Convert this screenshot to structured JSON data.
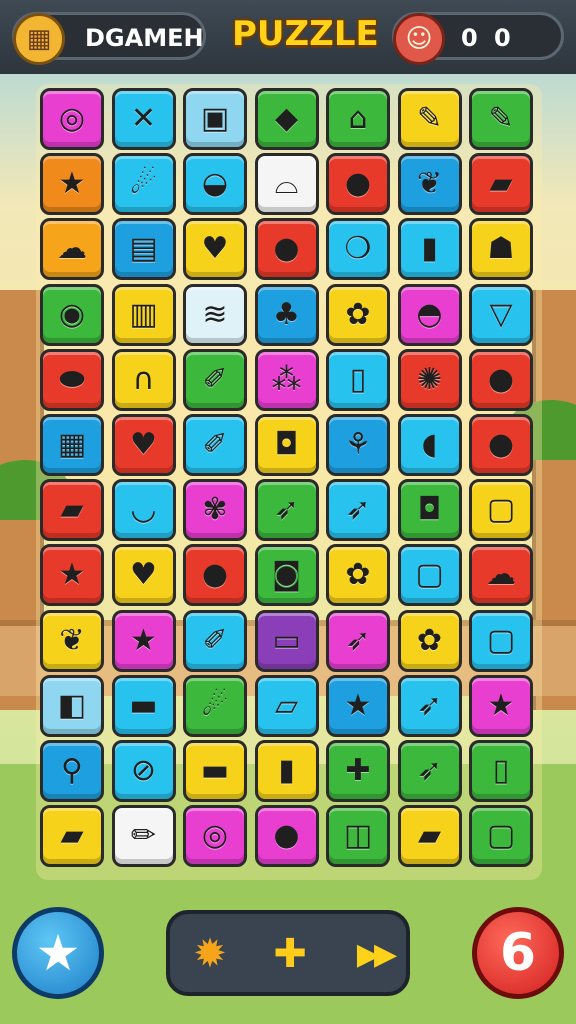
{
  "header": {
    "player_name": "DGAMEH",
    "title": "PUZZLE",
    "score": "0 0",
    "player_icon": "block-icon",
    "score_icon": "face-icon"
  },
  "board": {
    "rows": 12,
    "cols": 7,
    "tiles": [
      [
        {
          "color": "#e83fd1",
          "icon": "ring"
        },
        {
          "color": "#28c2ee",
          "icon": "cross"
        },
        {
          "color": "#8fd6f0",
          "icon": "screen"
        },
        {
          "color": "#3cb83c",
          "icon": "gem"
        },
        {
          "color": "#3cb83c",
          "icon": "pot"
        },
        {
          "color": "#f6d21a",
          "icon": "pen"
        },
        {
          "color": "#3cb83c",
          "icon": "pen"
        }
      ],
      [
        {
          "color": "#f08a1a",
          "icon": "star"
        },
        {
          "color": "#28c2ee",
          "icon": "pepper"
        },
        {
          "color": "#28c2ee",
          "icon": "bowl"
        },
        {
          "color": "#f5f5f5",
          "icon": "shoe"
        },
        {
          "color": "#e83a2a",
          "icon": "ball"
        },
        {
          "color": "#1ea0e0",
          "icon": "leaf"
        },
        {
          "color": "#e83a2a",
          "icon": "box"
        }
      ],
      [
        {
          "color": "#f6a51a",
          "icon": "cloud"
        },
        {
          "color": "#1ea0e0",
          "icon": "chip"
        },
        {
          "color": "#f6d21a",
          "icon": "apple"
        },
        {
          "color": "#e83a2a",
          "icon": "plum"
        },
        {
          "color": "#28c2ee",
          "icon": "eggplant"
        },
        {
          "color": "#28c2ee",
          "icon": "jar"
        },
        {
          "color": "#f6d21a",
          "icon": "ghost"
        }
      ],
      [
        {
          "color": "#3cb83c",
          "icon": "ball-chain"
        },
        {
          "color": "#f6d21a",
          "icon": "machine"
        },
        {
          "color": "#dff2f8",
          "icon": "sandwich"
        },
        {
          "color": "#1ea0e0",
          "icon": "bowl-plant"
        },
        {
          "color": "#f6d21a",
          "icon": "candy"
        },
        {
          "color": "#e83fd1",
          "icon": "fruit-bowl"
        },
        {
          "color": "#28c2ee",
          "icon": "dessert"
        }
      ],
      [
        {
          "color": "#e83a2a",
          "icon": "soap"
        },
        {
          "color": "#f6d21a",
          "icon": "horseshoe"
        },
        {
          "color": "#3cb83c",
          "icon": "crayon"
        },
        {
          "color": "#e83fd1",
          "icon": "grapes"
        },
        {
          "color": "#28c2ee",
          "icon": "bottle"
        },
        {
          "color": "#e83a2a",
          "icon": "cookie"
        },
        {
          "color": "#e83a2a",
          "icon": "ball"
        }
      ],
      [
        {
          "color": "#1ea0e0",
          "icon": "board"
        },
        {
          "color": "#e83a2a",
          "icon": "cherry"
        },
        {
          "color": "#28c2ee",
          "icon": "crayon"
        },
        {
          "color": "#f6d21a",
          "icon": "bag"
        },
        {
          "color": "#1ea0e0",
          "icon": "grass"
        },
        {
          "color": "#28c2ee",
          "icon": "drop"
        },
        {
          "color": "#e83a2a",
          "icon": "dot"
        }
      ],
      [
        {
          "color": "#e83a2a",
          "icon": "tube"
        },
        {
          "color": "#28c2ee",
          "icon": "lips"
        },
        {
          "color": "#e83fd1",
          "icon": "shell"
        },
        {
          "color": "#3cb83c",
          "icon": "carrot"
        },
        {
          "color": "#28c2ee",
          "icon": "carrot"
        },
        {
          "color": "#3cb83c",
          "icon": "bag"
        },
        {
          "color": "#f6d21a",
          "icon": "square"
        }
      ],
      [
        {
          "color": "#e83a2a",
          "icon": "star"
        },
        {
          "color": "#f6d21a",
          "icon": "apple"
        },
        {
          "color": "#e83a2a",
          "icon": "bubble"
        },
        {
          "color": "#3cb83c",
          "icon": "radio"
        },
        {
          "color": "#f6d21a",
          "icon": "flower"
        },
        {
          "color": "#28c2ee",
          "icon": "square"
        },
        {
          "color": "#e83a2a",
          "icon": "icecream"
        }
      ],
      [
        {
          "color": "#f6d21a",
          "icon": "leaf"
        },
        {
          "color": "#e83fd1",
          "icon": "star"
        },
        {
          "color": "#28c2ee",
          "icon": "crayon"
        },
        {
          "color": "#8a3fb8",
          "icon": "folder"
        },
        {
          "color": "#e83fd1",
          "icon": "carrot"
        },
        {
          "color": "#f6d21a",
          "icon": "flower"
        },
        {
          "color": "#28c2ee",
          "icon": "square"
        }
      ],
      [
        {
          "color": "#8fd6f0",
          "icon": "cube"
        },
        {
          "color": "#28c2ee",
          "icon": "cake"
        },
        {
          "color": "#3cb83c",
          "icon": "pepper"
        },
        {
          "color": "#28c2ee",
          "icon": "flag"
        },
        {
          "color": "#1ea0e0",
          "icon": "star"
        },
        {
          "color": "#28c2ee",
          "icon": "carrot"
        },
        {
          "color": "#e83fd1",
          "icon": "star"
        }
      ],
      [
        {
          "color": "#1ea0e0",
          "icon": "lollipop"
        },
        {
          "color": "#28c2ee",
          "icon": "pan"
        },
        {
          "color": "#f6d21a",
          "icon": "cake"
        },
        {
          "color": "#f6d21a",
          "icon": "jar"
        },
        {
          "color": "#3cb83c",
          "icon": "plus"
        },
        {
          "color": "#3cb83c",
          "icon": "carrot"
        },
        {
          "color": "#3cb83c",
          "icon": "bottle"
        }
      ],
      [
        {
          "color": "#f6d21a",
          "icon": "tube"
        },
        {
          "color": "#f5f5f5",
          "icon": "pencil"
        },
        {
          "color": "#e83fd1",
          "icon": "ring"
        },
        {
          "color": "#e83fd1",
          "icon": "ball"
        },
        {
          "color": "#3cb83c",
          "icon": "can"
        },
        {
          "color": "#f6d21a",
          "icon": "box"
        },
        {
          "color": "#3cb83c",
          "icon": "square"
        }
      ]
    ]
  },
  "footer": {
    "left_button_icon": "star-icon",
    "right_button_label": "6",
    "powerups": [
      "sun-icon",
      "puzzle-piece-icon",
      "fast-forward-icon"
    ]
  }
}
